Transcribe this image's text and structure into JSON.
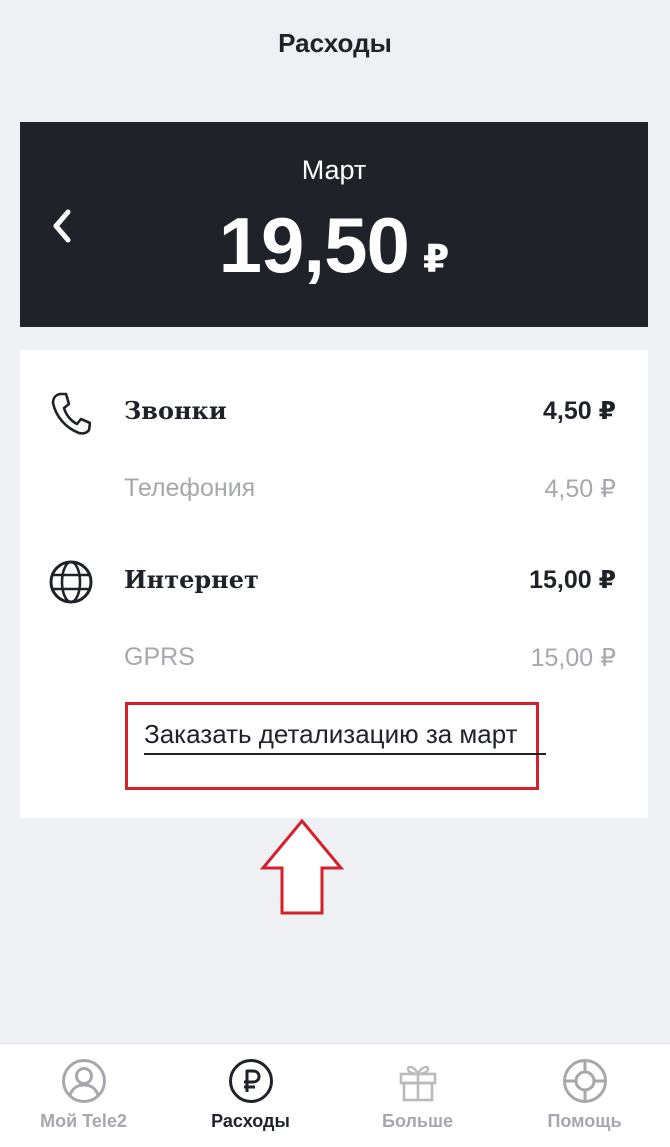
{
  "header": {
    "title": "Расходы"
  },
  "month_card": {
    "month": "Март",
    "amount": "19,50",
    "currency": "₽",
    "prev_icon": "chevron-left-icon"
  },
  "details": {
    "groups": [
      {
        "icon": "phone-icon",
        "label": "Звонки",
        "amount": "4,50 ₽",
        "sub_label": "Телефония",
        "sub_amount": "4,50 ₽"
      },
      {
        "icon": "globe-icon",
        "label": "Интернет",
        "amount": "15,00 ₽",
        "sub_label": "GPRS",
        "sub_amount": "15,00 ₽"
      }
    ],
    "order_link": "Заказать детализацию за март"
  },
  "annotation": {
    "highlight_color": "#d5202b",
    "arrow_icon": "arrow-up-outline-icon"
  },
  "bottom_nav": {
    "items": [
      {
        "label": "Мой Tele2",
        "icon": "user-icon",
        "active": false
      },
      {
        "label": "Расходы",
        "icon": "ruble-icon",
        "active": true
      },
      {
        "label": "Больше",
        "icon": "gift-icon",
        "active": false
      },
      {
        "label": "Помощь",
        "icon": "lifebuoy-icon",
        "active": false
      }
    ]
  },
  "colors": {
    "dark": "#1f2229",
    "muted": "#a6a8ad",
    "background": "#eff0f4",
    "accent": "#d5202b"
  }
}
